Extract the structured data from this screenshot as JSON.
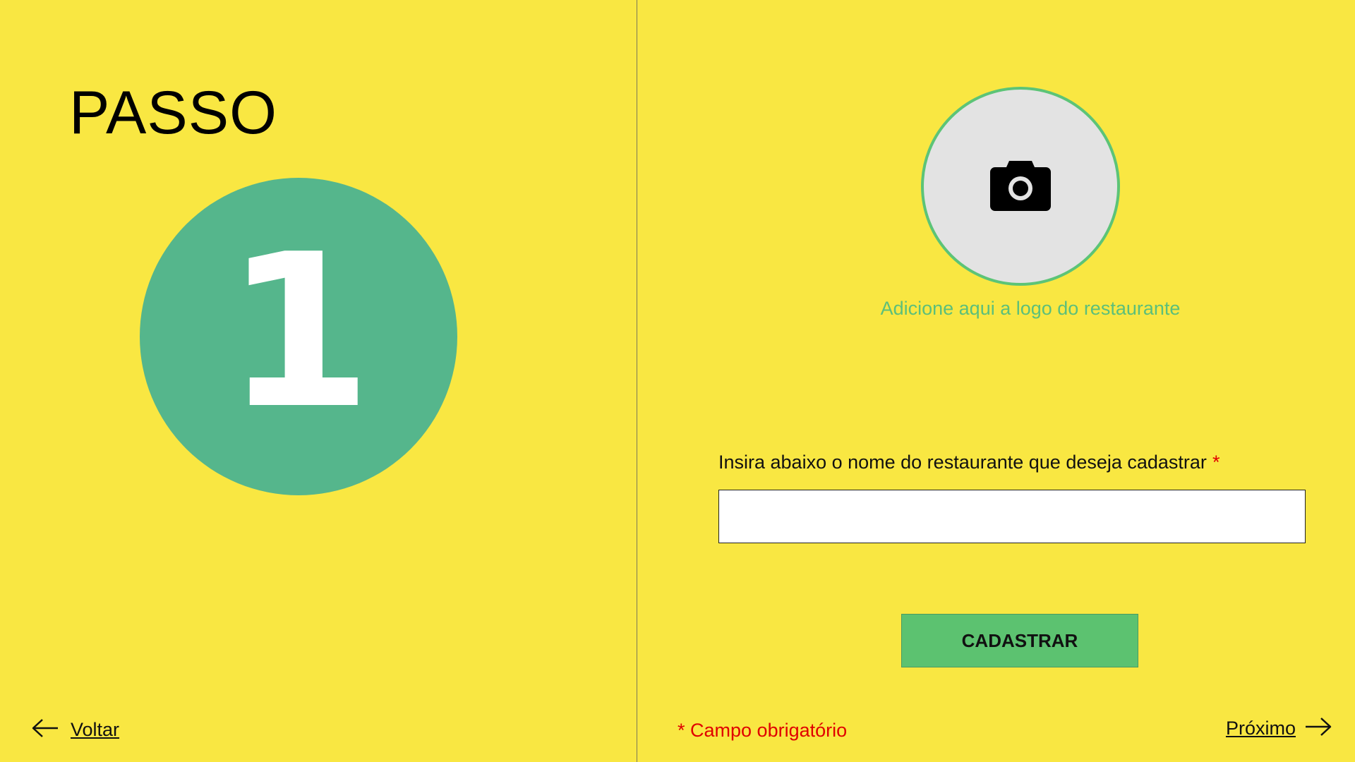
{
  "step": {
    "title": "PASSO",
    "number": "1",
    "circle_color": "#55b68c"
  },
  "logo_upload": {
    "icon": "camera-icon",
    "caption": "Adicione aqui a logo do restaurante",
    "accent_color": "#5cc477"
  },
  "form": {
    "name_label": "Insira abaixo o nome do restaurante que deseja cadastrar",
    "required_marker": "*",
    "name_value": "",
    "submit_label": "CADASTRAR"
  },
  "footer": {
    "back_label": "Voltar",
    "back_icon": "arrow-left-icon",
    "required_note": "* Campo obrigatório",
    "next_label": "Próximo",
    "next_icon": "arrow-right-icon"
  },
  "colors": {
    "background": "#f9e742",
    "required": "#e00000",
    "button": "#5cc270"
  }
}
